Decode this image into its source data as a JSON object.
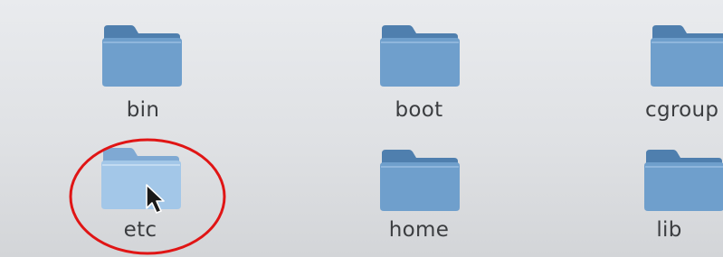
{
  "colors": {
    "folder_back": "#4f7fae",
    "folder_front": "#6f9fcc",
    "folder_selected_front": "#9cc3e6",
    "annotation": "#e01515"
  },
  "folders": [
    {
      "label": "bin",
      "icon": "folder-icon"
    },
    {
      "label": "boot",
      "icon": "folder-icon"
    },
    {
      "label": "cgroup",
      "icon": "folder-icon"
    },
    {
      "label": "etc",
      "icon": "folder-icon",
      "selected": true
    },
    {
      "label": "home",
      "icon": "folder-icon"
    },
    {
      "label": "lib",
      "icon": "folder-icon"
    }
  ],
  "pointer": {
    "icon": "mouse-pointer-icon"
  },
  "annotation": {
    "shape": "red-ellipse",
    "target": "etc"
  }
}
